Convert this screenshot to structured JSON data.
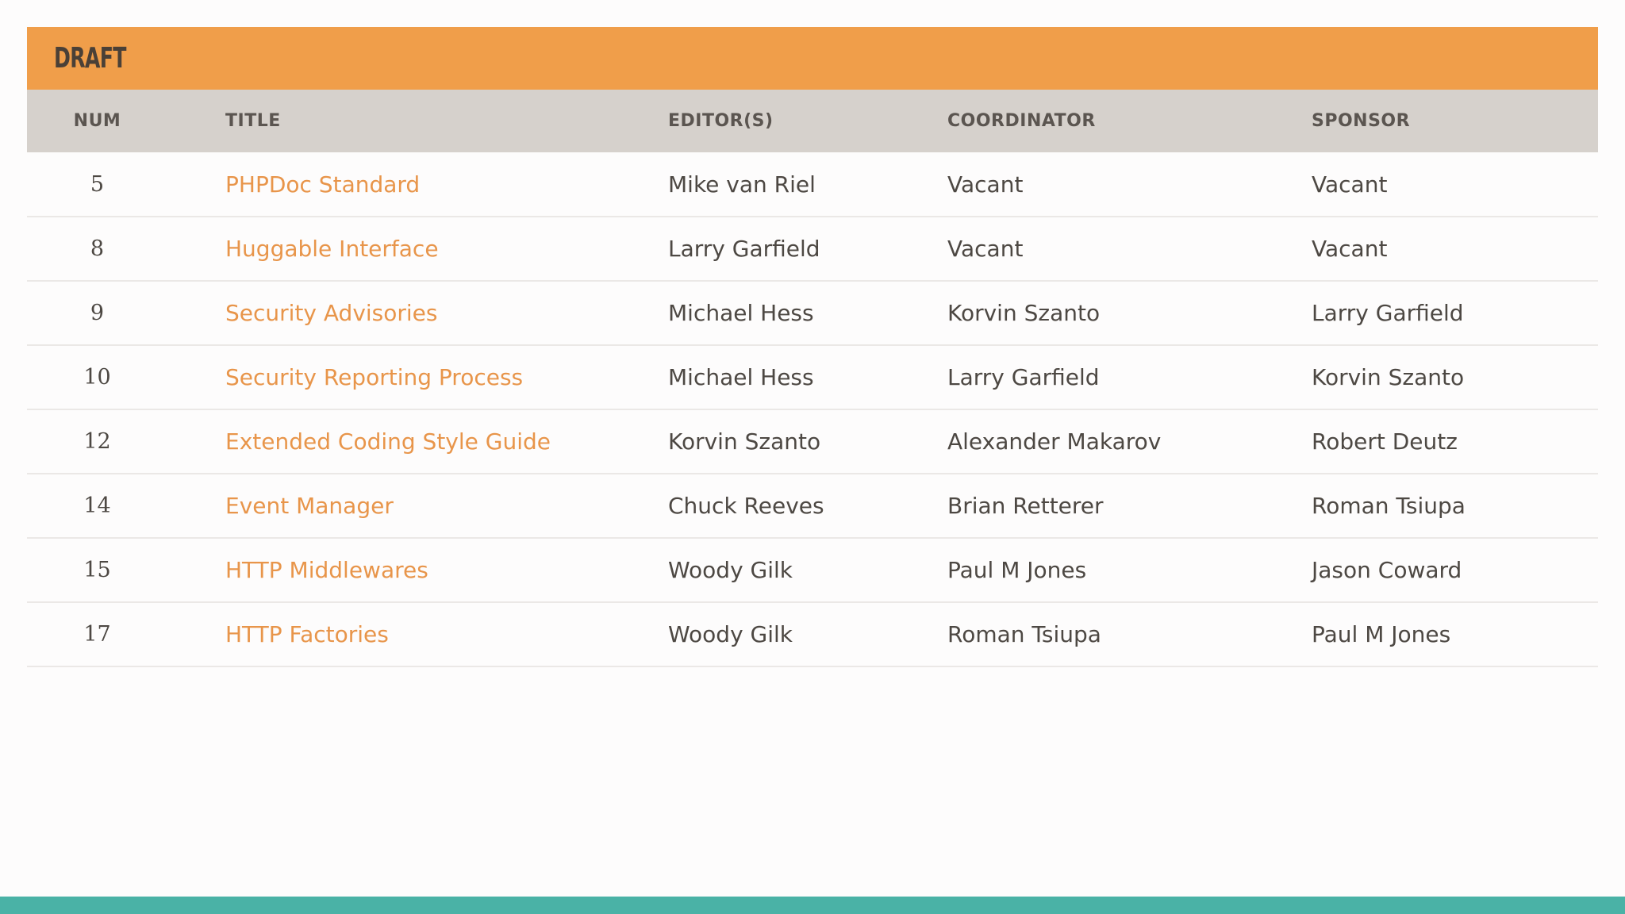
{
  "section": {
    "title": "DRAFT"
  },
  "table": {
    "headers": {
      "num": "NUM",
      "title": "TITLE",
      "editors": "EDITOR(S)",
      "coordinator": "COORDINATOR",
      "sponsor": "SPONSOR"
    },
    "rows": [
      {
        "num": "5",
        "title": "PHPDoc Standard",
        "editors": "Mike van Riel",
        "coordinator": "Vacant",
        "sponsor": "Vacant"
      },
      {
        "num": "8",
        "title": "Huggable Interface",
        "editors": "Larry Garfield",
        "coordinator": "Vacant",
        "sponsor": "Vacant"
      },
      {
        "num": "9",
        "title": "Security Advisories",
        "editors": "Michael Hess",
        "coordinator": "Korvin Szanto",
        "sponsor": "Larry Garfield"
      },
      {
        "num": "10",
        "title": "Security Reporting Process",
        "editors": "Michael Hess",
        "coordinator": "Larry Garfield",
        "sponsor": "Korvin Szanto"
      },
      {
        "num": "12",
        "title": "Extended Coding Style Guide",
        "editors": "Korvin Szanto",
        "coordinator": "Alexander Makarov",
        "sponsor": "Robert Deutz"
      },
      {
        "num": "14",
        "title": "Event Manager",
        "editors": "Chuck Reeves",
        "coordinator": "Brian Retterer",
        "sponsor": "Roman Tsiupa"
      },
      {
        "num": "15",
        "title": "HTTP Middlewares",
        "editors": "Woody Gilk",
        "coordinator": "Paul M Jones",
        "sponsor": "Jason Coward"
      },
      {
        "num": "17",
        "title": "HTTP Factories",
        "editors": "Woody Gilk",
        "coordinator": "Roman Tsiupa",
        "sponsor": "Paul M Jones"
      }
    ]
  },
  "colors": {
    "header_bar": "#f09e4a",
    "column_header_bg": "#d6d1cc",
    "link": "#e8954a",
    "footer_bar": "#4ab2a6"
  }
}
